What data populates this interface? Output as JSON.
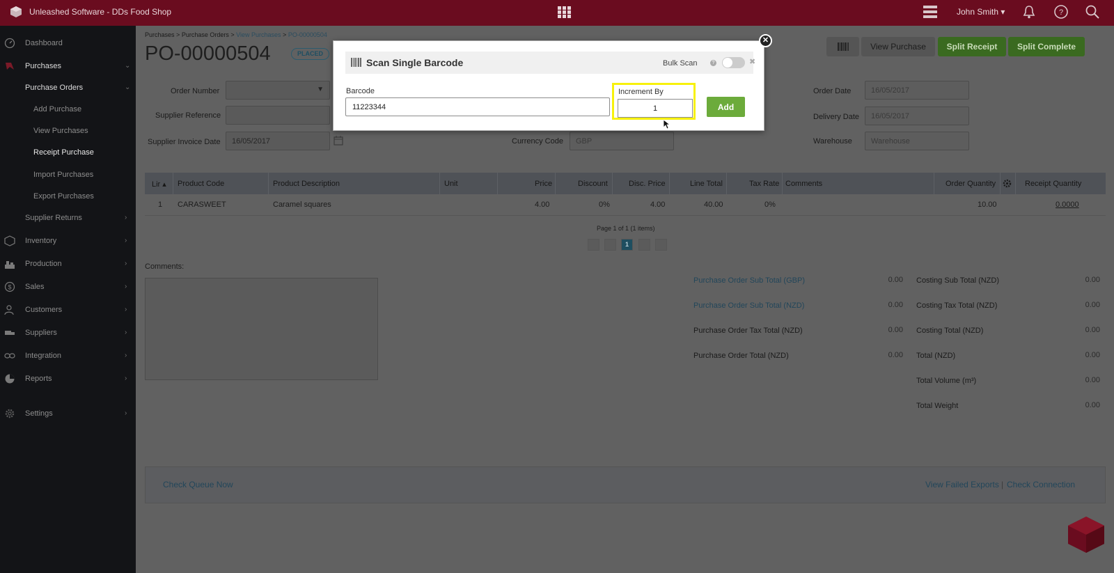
{
  "app": {
    "title": "Unleashed Software - DDs Food Shop",
    "user": "John Smith"
  },
  "sidebar": {
    "items": [
      {
        "label": "Dashboard",
        "icon": "dashboard-icon"
      },
      {
        "label": "Purchases",
        "icon": "purchases-icon"
      },
      {
        "label": "Purchase Orders"
      },
      {
        "label": "Add Purchase"
      },
      {
        "label": "View Purchases"
      },
      {
        "label": "Receipt Purchase"
      },
      {
        "label": "Import Purchases"
      },
      {
        "label": "Export Purchases"
      },
      {
        "label": "Supplier Returns"
      },
      {
        "label": "Inventory",
        "icon": "inventory-icon"
      },
      {
        "label": "Production",
        "icon": "production-icon"
      },
      {
        "label": "Sales",
        "icon": "sales-icon"
      },
      {
        "label": "Customers",
        "icon": "customers-icon"
      },
      {
        "label": "Suppliers",
        "icon": "suppliers-icon"
      },
      {
        "label": "Integration",
        "icon": "integration-icon"
      },
      {
        "label": "Reports",
        "icon": "reports-icon"
      },
      {
        "label": "Settings",
        "icon": "settings-icon"
      }
    ]
  },
  "breadcrumb": {
    "purchases": "Purchases",
    "purchase_orders": "Purchase Orders",
    "view_purchases": "View Purchases",
    "current": "PO-00000504",
    "sep": ">"
  },
  "page": {
    "title": "PO-00000504",
    "status": "PLACED"
  },
  "toolbar": {
    "view_purchase": "View Purchase",
    "split_receipt": "Split Receipt",
    "split_complete": "Split Complete"
  },
  "form": {
    "order_number_label": "Order Number",
    "supplier_reference_label": "Supplier Reference",
    "supplier_invoice_date_label": "Supplier Invoice Date",
    "supplier_invoice_date": "16/05/2017",
    "currency_code_label": "Currency Code",
    "currency_code": "GBP",
    "order_date_label": "Order Date",
    "order_date": "16/05/2017",
    "delivery_date_label": "Delivery Date",
    "delivery_date": "16/05/2017",
    "warehouse_label": "Warehouse",
    "warehouse": "Warehouse"
  },
  "table": {
    "headers": [
      "Lir",
      "Product Code",
      "Product Description",
      "Unit",
      "Price",
      "Discount",
      "Disc. Price",
      "Line Total",
      "Tax Rate",
      "Comments",
      "Order Quantity",
      "Receipt Quantity"
    ],
    "rows": [
      {
        "line": "1",
        "code": "CARASWEET",
        "description": "Caramel squares",
        "unit": "",
        "price": "4.00",
        "discount": "0%",
        "disc_price": "4.00",
        "line_total": "40.00",
        "tax_rate": "0%",
        "comments": "",
        "order_qty": "10.00",
        "receipt_qty": "0.0000"
      }
    ],
    "page_info": "Page 1 of 1 (1 items)",
    "current_page": "1"
  },
  "comments_label": "Comments:",
  "totals": {
    "po_sub_gbp_label": "Purchase Order Sub Total (GBP)",
    "po_sub_gbp": "0.00",
    "po_sub_nzd_label": "Purchase Order Sub Total (NZD)",
    "po_sub_nzd": "0.00",
    "po_tax_label": "Purchase Order Tax Total (NZD)",
    "po_tax": "0.00",
    "po_total_label": "Purchase Order Total (NZD)",
    "po_total": "0.00",
    "costing_sub_label": "Costing Sub Total (NZD)",
    "costing_sub": "0.00",
    "costing_tax_label": "Costing Tax Total (NZD)",
    "costing_tax": "0.00",
    "costing_total_label": "Costing Total (NZD)",
    "costing_total": "0.00",
    "total_label": "Total (NZD)",
    "total": "0.00",
    "volume_label": "Total Volume (m³)",
    "volume": "0.00",
    "weight_label": "Total Weight",
    "weight": "0.00"
  },
  "footer": {
    "check_queue": "Check Queue Now",
    "view_failed": "View Failed Exports",
    "check_connection": "Check Connection",
    "sep": "|"
  },
  "modal": {
    "title": "Scan Single Barcode",
    "bulk_scan_label": "Bulk Scan",
    "bulk_scan_on": false,
    "barcode_label": "Barcode",
    "barcode_value": "11223344",
    "increment_label": "Increment By",
    "increment_value": "1",
    "add_label": "Add"
  },
  "colors": {
    "brand": "#6a0c1f",
    "accent_green": "#6cab3b",
    "highlight": "#f7f10b"
  }
}
